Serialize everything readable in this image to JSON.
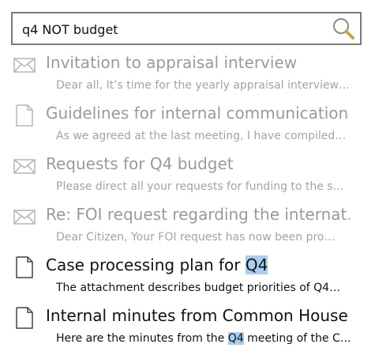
{
  "search": {
    "query": "q4 NOT budget",
    "button_icon": "search-icon"
  },
  "results": [
    {
      "icon": "envelope-icon",
      "title": "Invitation to appraisal interview",
      "preview": "Dear all, It’s time for the yearly appraisal interview…",
      "state": "dim"
    },
    {
      "icon": "document-icon",
      "title": "Guidelines for internal communication",
      "preview": "As we agreed at the last meeting, I have compiled…",
      "state": "dim"
    },
    {
      "icon": "envelope-icon",
      "title": "Requests for Q4 budget",
      "preview": "Please direct all your requests for funding to the s…",
      "state": "dim"
    },
    {
      "icon": "envelope-icon",
      "title": "Re: FOI request regarding the internat…",
      "preview": "Dear Citizen, Your FOI request has now been pro…",
      "state": "dim"
    },
    {
      "icon": "document-icon",
      "title_before": "Case processing plan for ",
      "title_highlight": "Q4",
      "title_after": "",
      "preview": "The attachment describes budget priorities of Q4…",
      "state": "active"
    },
    {
      "icon": "document-icon",
      "title": "Internal minutes from Common House…",
      "preview_before": "Here are the minutes from the ",
      "preview_highlight": "Q4",
      "preview_after": " meeting of the C…",
      "state": "active"
    }
  ],
  "colors": {
    "highlight": "#a8cdf0",
    "dim_text": "#9a9a9a",
    "border": "#7a7a7a"
  }
}
